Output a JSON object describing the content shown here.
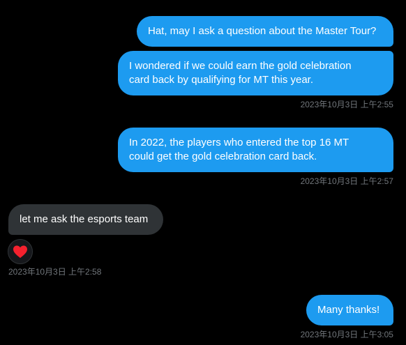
{
  "messages": [
    {
      "id": "m1",
      "direction": "sent",
      "text": "Hat, may I ask a question about the Master Tour?"
    },
    {
      "id": "m2",
      "direction": "sent",
      "lines": [
        "I wondered if we could earn the gold celebration",
        "card back by qualifying for MT this year."
      ]
    },
    {
      "id": "m3",
      "direction": "sent",
      "lines": [
        "In 2022, the players who entered the top 16 MT",
        "could get the gold celebration card back."
      ]
    },
    {
      "id": "m4",
      "direction": "received",
      "text": "let me ask the esports team"
    },
    {
      "id": "m5",
      "direction": "sent",
      "text": "Many thanks!"
    }
  ],
  "timestamps": {
    "t1": "2023年10月3日 上午2:55",
    "t2": "2023年10月3日 上午2:57",
    "t3": "2023年10月3日 上午2:58",
    "t4": "2023年10月3日 上午3:05"
  },
  "reaction": {
    "icon": "heart-icon",
    "color": "#f91880"
  },
  "colors": {
    "background": "#000000",
    "sent_bubble": "#1d9bf0",
    "received_bubble": "#2f3336",
    "timestamp": "#71767b"
  }
}
